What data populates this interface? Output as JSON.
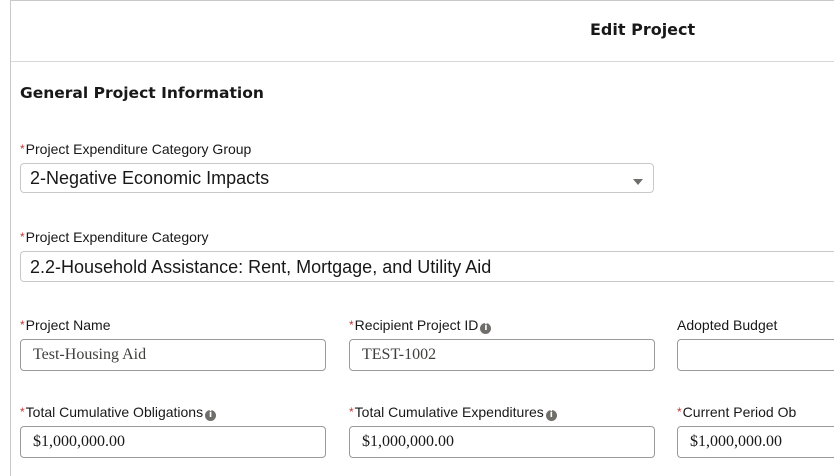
{
  "header": {
    "title": "Edit Project"
  },
  "section": {
    "title": "General Project Information"
  },
  "fields": {
    "category_group": {
      "label": "Project Expenditure Category Group",
      "required": true,
      "value": "2-Negative Economic Impacts"
    },
    "category": {
      "label": "Project Expenditure Category",
      "required": true,
      "value": "2.2-Household Assistance: Rent, Mortgage, and Utility Aid"
    },
    "project_name": {
      "label": "Project Name",
      "required": true,
      "value": "Test-Housing Aid"
    },
    "recipient_project_id": {
      "label": "Recipient Project ID",
      "required": true,
      "has_info": true,
      "value": "TEST-1002"
    },
    "adopted_budget": {
      "label": "Adopted Budget",
      "required": false,
      "value": ""
    },
    "total_cumulative_obligations": {
      "label": "Total Cumulative Obligations",
      "required": true,
      "has_info": true,
      "value": "$1,000,000.00"
    },
    "total_cumulative_expenditures": {
      "label": "Total Cumulative Expenditures",
      "required": true,
      "has_info": true,
      "value": "$1,000,000.00"
    },
    "current_period_obligations": {
      "label": "Current Period Ob",
      "required": true,
      "value": "$1,000,000.00"
    }
  },
  "symbols": {
    "required_marker": "*",
    "info_glyph": "i"
  },
  "icons": {
    "info": "info-icon",
    "dropdown": "chevron-down-icon"
  },
  "colors": {
    "required": "#c23934",
    "border": "#c9c9c9",
    "text": "#181818"
  }
}
